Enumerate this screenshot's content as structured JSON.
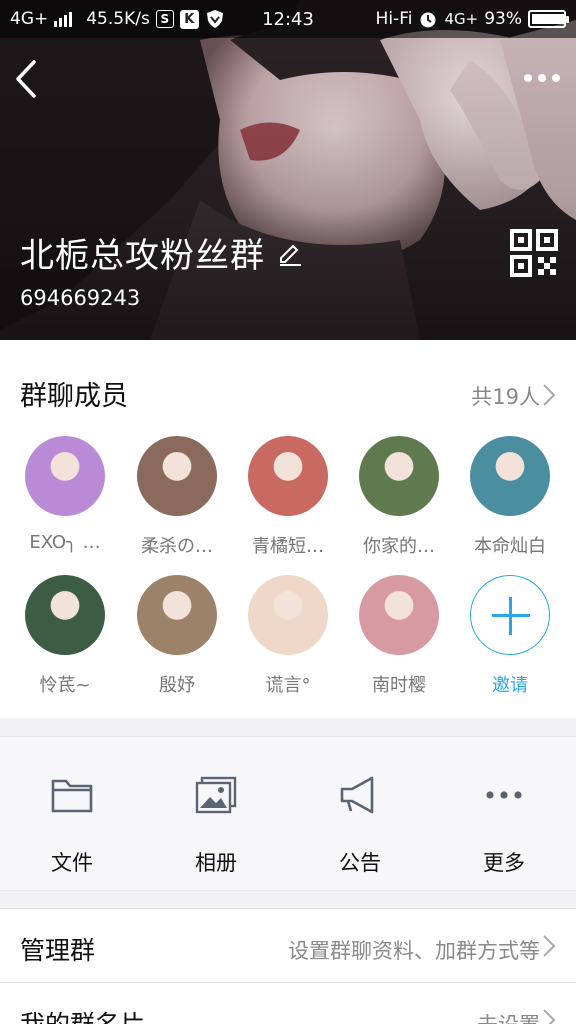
{
  "status_bar": {
    "network": "4G+",
    "speed": "45.5K/s",
    "time": "12:43",
    "hifi": "Hi-Fi",
    "network2": "4G+",
    "battery": "93%",
    "battery_level": 0.93
  },
  "header": {
    "group_name": "北栀总攻粉丝群",
    "group_id": "694669243"
  },
  "members": {
    "title": "群聊成员",
    "count": "共19人",
    "list": [
      {
        "name": "EXO╮ …",
        "color": "#b98bd6"
      },
      {
        "name": "柔杀の…",
        "color": "#8a6a5c"
      },
      {
        "name": "青橘短…",
        "color": "#c86a62"
      },
      {
        "name": "你家的…",
        "color": "#5e7a4e"
      },
      {
        "name": "本命灿白",
        "color": "#4a8ea0"
      },
      {
        "name": "怜茋~",
        "color": "#3c5c44"
      },
      {
        "name": "殷妤",
        "color": "#9c8268"
      },
      {
        "name": "谎言°",
        "color": "#f0d8c8"
      },
      {
        "name": "南时樱",
        "color": "#d89aa2"
      }
    ],
    "invite": "邀请"
  },
  "tools": [
    {
      "label": "文件",
      "icon": "folder-icon"
    },
    {
      "label": "相册",
      "icon": "album-icon"
    },
    {
      "label": "公告",
      "icon": "megaphone-icon"
    },
    {
      "label": "更多",
      "icon": "more-dots-icon"
    }
  ],
  "rows": {
    "manage_label": "管理群",
    "manage_value": "设置群聊资料、加群方式等",
    "card_label": "我的群名片",
    "card_value": "未设置"
  },
  "colors": {
    "accent": "#2aa6e8",
    "icon_gray": "#5a6472"
  }
}
